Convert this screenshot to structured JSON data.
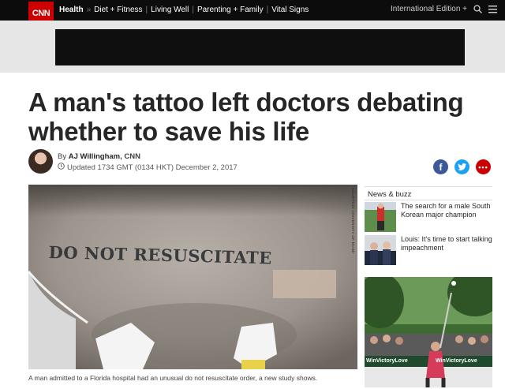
{
  "nav": {
    "logo": "CNN",
    "links": [
      "Health",
      "Diet + Fitness",
      "Living Well",
      "Parenting + Family",
      "Vital Signs"
    ],
    "separator_after_health": "»",
    "edition": "International Edition +",
    "icons": [
      "search-icon",
      "menu-icon"
    ]
  },
  "article": {
    "headline": "A man's tattoo left doctors debating whether to save his life",
    "by_prefix": "By",
    "author": "AJ Willingham",
    "outlet": ", CNN",
    "updated": "Updated 1734 GMT (0134 HKT) December 2, 2017",
    "image_text": "DO NOT RESUSCITATE",
    "image_credit": "COURTESY UNIVERSITY OF MIAMI",
    "caption": "A man admitted to a Florida hospital had an unusual do not resuscitate order, a new study shows."
  },
  "share": {
    "icons": [
      "facebook-icon",
      "twitter-icon",
      "more-icon"
    ],
    "colors": {
      "facebook": "#3b5998",
      "twitter": "#1da1f2",
      "more": "#cc0000"
    }
  },
  "rail": {
    "title": "News & buzz",
    "items": [
      {
        "text": "The search for a male South Korean major champion"
      },
      {
        "text": "Louis: It's time to start talking impeachment"
      }
    ],
    "ad_text": [
      "WinVictoryLove",
      "WinVictoryLove"
    ]
  },
  "colors": {
    "brand": "#cc0000",
    "nav_bg": "#0c0c0c"
  }
}
